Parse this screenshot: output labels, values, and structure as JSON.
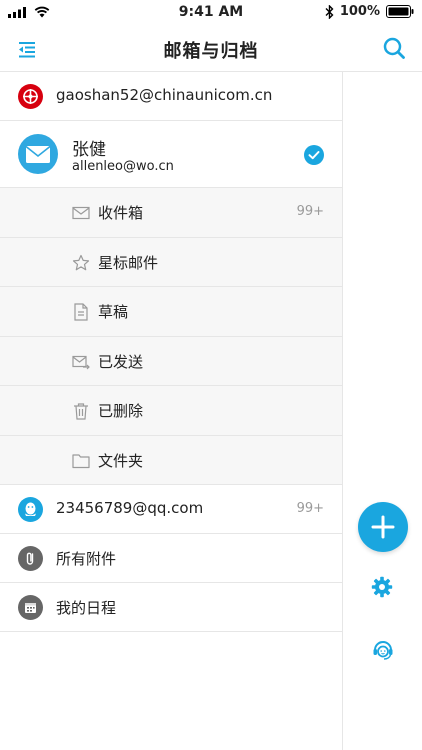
{
  "status_bar": {
    "time": "9:41 AM",
    "battery": "100%"
  },
  "nav": {
    "title": "邮箱与归档"
  },
  "accounts": {
    "unicom": {
      "email": "gaoshan52@chinaunicom.cn"
    },
    "wo": {
      "name": "张健",
      "email": "allenleo@wo.cn"
    },
    "qq": {
      "email": "23456789@qq.com",
      "badge": "99+"
    }
  },
  "folders": {
    "inbox": {
      "label": "收件箱",
      "badge": "99+"
    },
    "starred": {
      "label": "星标邮件"
    },
    "drafts": {
      "label": "草稿"
    },
    "sent": {
      "label": "已发送"
    },
    "deleted": {
      "label": "已删除"
    },
    "folder": {
      "label": "文件夹"
    }
  },
  "extras": {
    "attachments": {
      "label": "所有附件"
    },
    "schedule": {
      "label": "我的日程"
    }
  },
  "colors": {
    "accent": "#1aa6df",
    "unicom_red": "#d7000f",
    "qq_blue": "#1aa6df",
    "gray_icon": "#666666"
  },
  "icons": [
    "menu-icon",
    "search-icon",
    "unicom-logo-icon",
    "mail-avatar-icon",
    "check-icon",
    "inbox-icon",
    "star-icon",
    "document-icon",
    "sent-icon",
    "trash-icon",
    "folder-icon",
    "qq-icon",
    "paperclip-icon",
    "calendar-icon",
    "plus-icon",
    "gear-icon",
    "customer-service-icon"
  ]
}
